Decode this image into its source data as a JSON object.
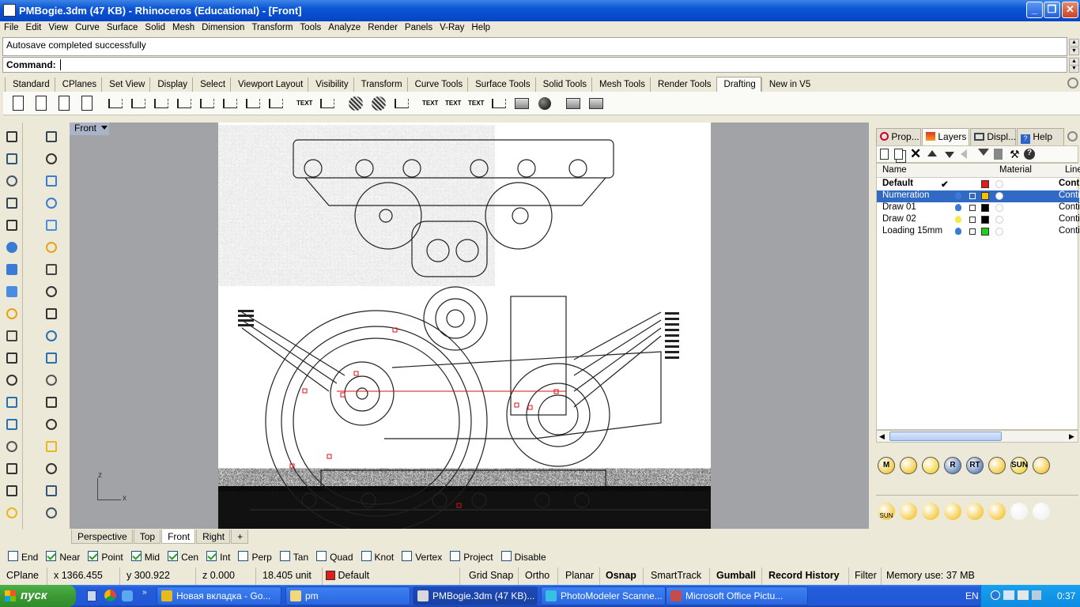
{
  "window": {
    "title": "PMBogie.3dm (47 KB) - Rhinoceros (Educational) - [Front]",
    "buttons": [
      "_",
      "❐",
      "✕"
    ]
  },
  "menu": [
    "File",
    "Edit",
    "View",
    "Curve",
    "Surface",
    "Solid",
    "Mesh",
    "Dimension",
    "Transform",
    "Tools",
    "Analyze",
    "Render",
    "Panels",
    "V-Ray",
    "Help"
  ],
  "command": {
    "history": "Autosave completed successfully",
    "prompt": "Command:",
    "value": ""
  },
  "toolbar_tabs": [
    "Standard",
    "CPlanes",
    "Set View",
    "Display",
    "Select",
    "Viewport Layout",
    "Visibility",
    "Transform",
    "Curve Tools",
    "Surface Tools",
    "Solid Tools",
    "Mesh Tools",
    "Render Tools",
    "Drafting",
    "New in V5"
  ],
  "active_toolbar_tab": "Drafting",
  "drafting_icons": [
    "new-layout-icon",
    "new-detail-icon",
    "new-page-icon",
    "page-setup-icon",
    "linear-dimension-icon",
    "aligned-dimension-icon",
    "rotated-dimension-icon",
    "ordinate-dimension-icon",
    "angle-dimension-icon",
    "slope-dimension-icon",
    "radius-dimension-icon",
    "diameter-dimension-icon",
    "text-block-icon",
    "leader-icon",
    "hatch-icon",
    "section-icon",
    "annotation-style-icon",
    "text-icon",
    "text-object-icon",
    "text-edit-icon",
    "make-2d-icon",
    "clipping-plane-icon",
    "dot-icon",
    "print-icon",
    "make-2d-layer-icon"
  ],
  "text_icon_label": "TEXT",
  "viewport": {
    "label": "Front",
    "axis_z": "z",
    "axis_x": "x"
  },
  "view_tabs": [
    "Perspective",
    "Top",
    "Front",
    "Right",
    "+"
  ],
  "active_view_tab": "Front",
  "panel_tabs": [
    "Prop...",
    "Layers",
    "Displ...",
    "Help"
  ],
  "active_panel_tab": "Layers",
  "layers": {
    "columns": [
      "Name",
      "Material",
      "Line"
    ],
    "rows": [
      {
        "name": "Default",
        "current": "✔",
        "color": "#e21b1b",
        "linetype": "Cont",
        "bold": true,
        "selected": false
      },
      {
        "name": "Numeration",
        "current": "",
        "color": "#f2c200",
        "linetype": "Contin",
        "bold": false,
        "selected": true
      },
      {
        "name": "Draw 01",
        "current": "",
        "color": "#000000",
        "linetype": "Contin",
        "bold": false,
        "selected": false
      },
      {
        "name": "Draw 02",
        "current": "",
        "color": "#000000",
        "linetype": "Contin",
        "bold": false,
        "selected": false
      },
      {
        "name": "Loading 15mm",
        "current": "",
        "color": "#1bd21b",
        "linetype": "Contin",
        "bold": false,
        "selected": false
      }
    ]
  },
  "render_icons_row1": [
    "M",
    "",
    "",
    "R",
    "RT",
    "",
    "SUN",
    ""
  ],
  "render_icons_row2": [
    "SUN",
    "",
    "",
    "",
    "",
    "",
    "",
    ""
  ],
  "osnaps": [
    {
      "label": "End",
      "on": false
    },
    {
      "label": "Near",
      "on": true
    },
    {
      "label": "Point",
      "on": true
    },
    {
      "label": "Mid",
      "on": true
    },
    {
      "label": "Cen",
      "on": true
    },
    {
      "label": "Int",
      "on": true
    },
    {
      "label": "Perp",
      "on": false
    },
    {
      "label": "Tan",
      "on": false
    },
    {
      "label": "Quad",
      "on": false
    },
    {
      "label": "Knot",
      "on": false
    },
    {
      "label": "Vertex",
      "on": false
    },
    {
      "label": "Project",
      "on": false
    },
    {
      "label": "Disable",
      "on": false
    }
  ],
  "status": {
    "cplane": "CPlane",
    "x": "x 1366.455",
    "y": "y 300.922",
    "z": "z 0.000",
    "unit": "18.405 unit",
    "layer": "Default",
    "layer_color": "#e21b1b",
    "grid_snap": "Grid Snap",
    "ortho": "Ortho",
    "planar": "Planar",
    "osnap": "Osnap",
    "smarttrack": "SmartTrack",
    "gumball": "Gumball",
    "record_history": "Record History",
    "filter": "Filter",
    "memory": "Memory use: 37 MB"
  },
  "taskbar": {
    "start": "пуск",
    "tasks": [
      {
        "label": "Новая вкладка - Go...",
        "color": "#e6b91c"
      },
      {
        "label": "pm",
        "color": "#f4d77a"
      },
      {
        "label": "PMBogie.3dm (47 KB)...",
        "color": "#d9d9d9"
      },
      {
        "label": "PhotoModeler Scanne...",
        "color": "#36c0e6"
      },
      {
        "label": "Microsoft Office Pictu...",
        "color": "#c84b4b"
      }
    ],
    "lang": "EN",
    "clock": "0:37"
  }
}
